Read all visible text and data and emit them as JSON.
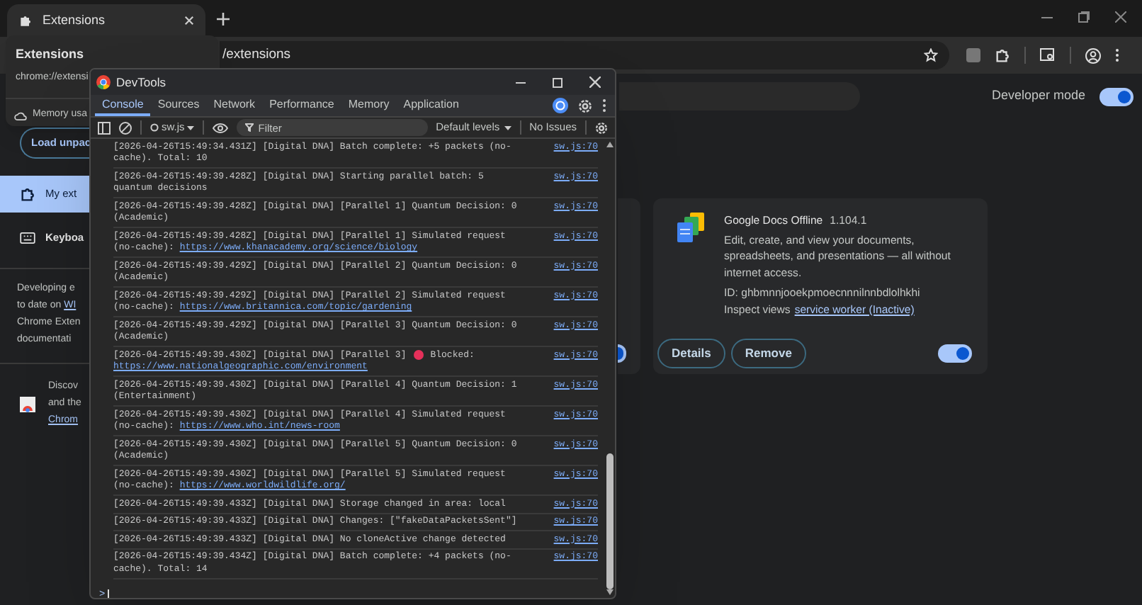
{
  "browser": {
    "tab": {
      "title": "Extensions"
    },
    "address": "/extensions"
  },
  "hover_card": {
    "title": "Extensions",
    "url": "chrome://extensi",
    "memory": "Memory usa"
  },
  "page": {
    "load_button": "Load unpac",
    "developer_mode": {
      "label": "Developer mode",
      "on": true
    },
    "sidebar": [
      {
        "label": "My ext",
        "selected": true
      },
      {
        "label": "Keyboa",
        "selected": false
      }
    ],
    "note_lines": [
      {
        "text": "Developing e"
      },
      {
        "text": "to date on ",
        "link": "WI"
      },
      {
        "text": "Chrome Exten"
      },
      {
        "text": "documentati"
      }
    ],
    "discover_lines": [
      {
        "text": "Discov"
      },
      {
        "text": "and the"
      },
      {
        "link": "Chrom"
      }
    ],
    "cards": [
      {
        "on": true
      },
      {
        "name": "Google Docs Offline",
        "version": "1.104.1",
        "description": "Edit, create, and view your documents, spreadsheets, and presentations — all without internet access.",
        "id": "ID: ghbmnnjooekpmoecnnnilnnbdlolhkhi",
        "inspect_label": "Inspect views",
        "inspect_link": "service worker (Inactive)",
        "buttons": [
          "Details",
          "Remove"
        ],
        "on": true
      }
    ]
  },
  "devtools": {
    "title": "DevTools",
    "tabs": [
      {
        "label": "Console",
        "selected": true
      },
      {
        "label": "Sources",
        "selected": false
      },
      {
        "label": "Network",
        "selected": false
      },
      {
        "label": "Performance",
        "selected": false
      },
      {
        "label": "Memory",
        "selected": false
      },
      {
        "label": "Application",
        "selected": false
      }
    ],
    "context": "sw.js",
    "filter_placeholder": "Filter",
    "levels": "Default levels",
    "issues": "No Issues",
    "logs": [
      {
        "kind": "message",
        "text": "[2026-04-26T15:49:34.431Z] [Digital DNA] Batch complete: +5 packets (no-cache). Total: 10",
        "source": "sw.js:70"
      },
      {
        "kind": "message",
        "text": "[2026-04-26T15:49:39.428Z] [Digital DNA] Starting parallel batch: 5 quantum decisions",
        "source": "sw.js:70"
      },
      {
        "kind": "message",
        "text": "[2026-04-26T15:49:39.428Z] [Digital DNA] [Parallel 1] Quantum Decision: 0 (Academic)",
        "source": "sw.js:70"
      },
      {
        "kind": "message",
        "text": "[2026-04-26T15:49:39.428Z] [Digital DNA] [Parallel 1] Simulated request (no-cache):",
        "url": "https://www.khanacademy.org/science/biology",
        "source": "sw.js:70"
      },
      {
        "kind": "message",
        "text": "[2026-04-26T15:49:39.429Z] [Digital DNA] [Parallel 2] Quantum Decision: 0 (Academic)",
        "source": "sw.js:70"
      },
      {
        "kind": "message",
        "text": "[2026-04-26T15:49:39.429Z] [Digital DNA] [Parallel 2] Simulated request (no-cache):",
        "url": "https://www.britannica.com/topic/gardening",
        "source": "sw.js:70"
      },
      {
        "kind": "message",
        "text": "[2026-04-26T15:49:39.429Z] [Digital DNA] [Parallel 3] Quantum Decision: 0 (Academic)",
        "source": "sw.js:70"
      },
      {
        "kind": "blocked",
        "text": "[2026-04-26T15:49:39.430Z] [Digital DNA] [Parallel 3]",
        "after": "Blocked:",
        "url": "https://www.nationalgeographic.com/environment",
        "source": "sw.js:70"
      },
      {
        "kind": "message",
        "text": "[2026-04-26T15:49:39.430Z] [Digital DNA] [Parallel 4] Quantum Decision: 1 (Entertainment)",
        "source": "sw.js:70"
      },
      {
        "kind": "message",
        "text": "[2026-04-26T15:49:39.430Z] [Digital DNA] [Parallel 4] Simulated request (no-cache):",
        "url": "https://www.who.int/news-room",
        "source": "sw.js:70"
      },
      {
        "kind": "message",
        "text": "[2026-04-26T15:49:39.430Z] [Digital DNA] [Parallel 5] Quantum Decision: 0 (Academic)",
        "source": "sw.js:70"
      },
      {
        "kind": "message",
        "text": "[2026-04-26T15:49:39.430Z] [Digital DNA] [Parallel 5] Simulated request (no-cache):",
        "url": "https://www.worldwildlife.org/",
        "source": "sw.js:70"
      },
      {
        "kind": "message",
        "text": "[2026-04-26T15:49:39.433Z] [Digital DNA] Storage changed in area: local",
        "source": "sw.js:70"
      },
      {
        "kind": "message",
        "text": "[2026-04-26T15:49:39.433Z] [Digital DNA] Changes: [\"fakeDataPacketsSent\"]",
        "source": "sw.js:70"
      },
      {
        "kind": "message",
        "text": "[2026-04-26T15:49:39.433Z] [Digital DNA] No cloneActive change detected",
        "source": "sw.js:70"
      },
      {
        "kind": "message",
        "text": "[2026-04-26T15:49:39.434Z] [Digital DNA] Batch complete: +4 packets (no-cache). Total: 14",
        "source": "sw.js:70"
      }
    ],
    "prompt": ">"
  }
}
